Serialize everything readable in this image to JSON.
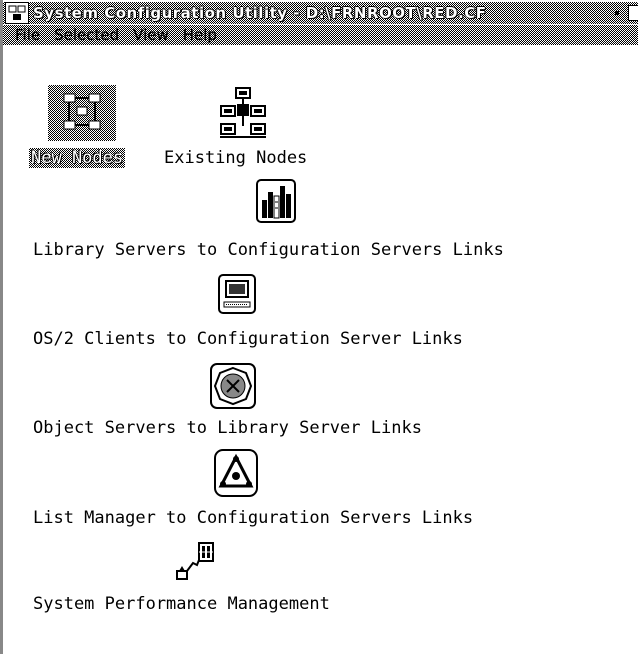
{
  "window": {
    "title": "System Configuration Utility - D:\\FRNROOT\\RED.CF"
  },
  "menubar": {
    "items": [
      {
        "label": "File"
      },
      {
        "label": "Selected"
      },
      {
        "label": "View"
      },
      {
        "label": "Help"
      }
    ]
  },
  "objects": [
    {
      "label": "New Nodes",
      "icon": "network-nodes-icon",
      "selected": true
    },
    {
      "label": "Existing Nodes",
      "icon": "computers-tree-icon"
    },
    {
      "label": "Library Servers to Configuration Servers Links",
      "icon": "library-books-icon"
    },
    {
      "label": "OS/2 Clients to Configuration Server Links",
      "icon": "computer-monitor-icon"
    },
    {
      "label": "Object Servers to Library Server Links",
      "icon": "object-server-icon"
    },
    {
      "label": "List Manager to Configuration Servers Links",
      "icon": "triangle-network-icon"
    },
    {
      "label": "System Performance Management",
      "icon": "performance-chart-icon"
    }
  ]
}
